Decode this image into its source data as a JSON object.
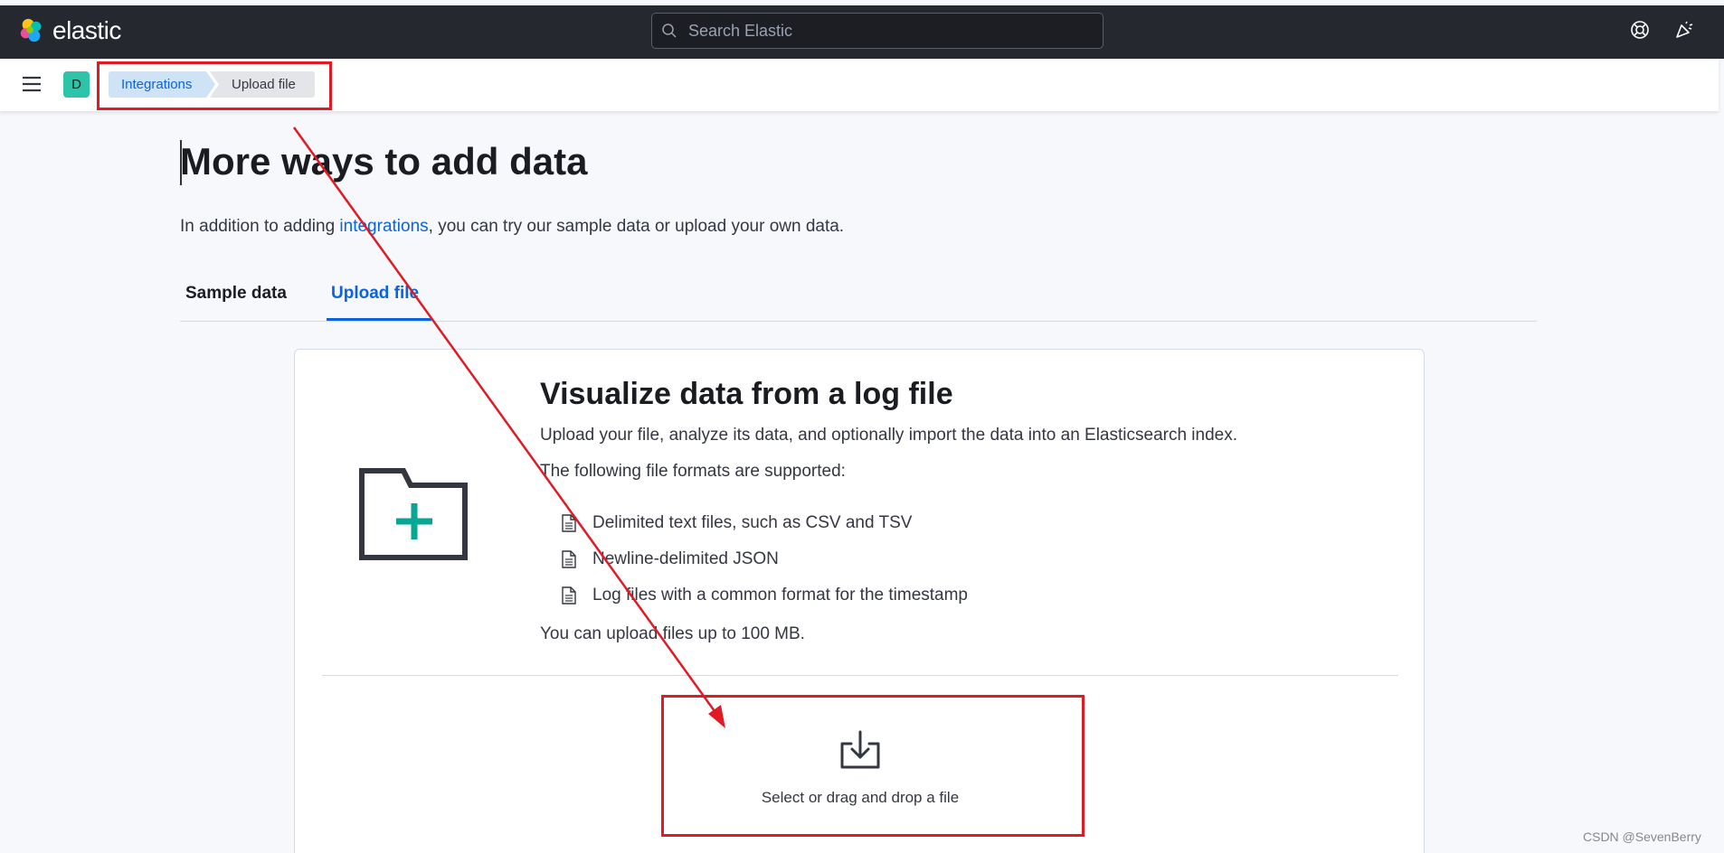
{
  "topbar": {
    "logo_text": "elastic",
    "search_placeholder": "Search Elastic",
    "icons": [
      "help-icon",
      "newsfeed-icon"
    ]
  },
  "subbar": {
    "menu_icon": "hamburger-menu-icon",
    "space_initial": "D",
    "breadcrumbs": [
      "Integrations",
      "Upload file"
    ]
  },
  "page": {
    "title": "More ways to add data",
    "intro_before": "In addition to adding ",
    "intro_link": "integrations",
    "intro_after": ", you can try our sample data or upload your own data.",
    "tabs": [
      "Sample data",
      "Upload file"
    ],
    "active_tab": "Upload file"
  },
  "card": {
    "title": "Visualize data from a log file",
    "description": "Upload your file, analyze its data, and optionally import the data into an Elasticsearch index.",
    "formats_label": "The following file formats are supported:",
    "formats": [
      "Delimited text files, such as CSV and TSV",
      "Newline-delimited JSON",
      "Log files with a common format for the timestamp"
    ],
    "limit_text": "You can upload files up to 100 MB.",
    "dropzone_label": "Select or drag and drop a file"
  },
  "colors": {
    "accent": "#0b64dd",
    "annotation": "#e01b24",
    "folder_plus": "#07a695"
  },
  "watermark": "CSDN @SevenBerry"
}
